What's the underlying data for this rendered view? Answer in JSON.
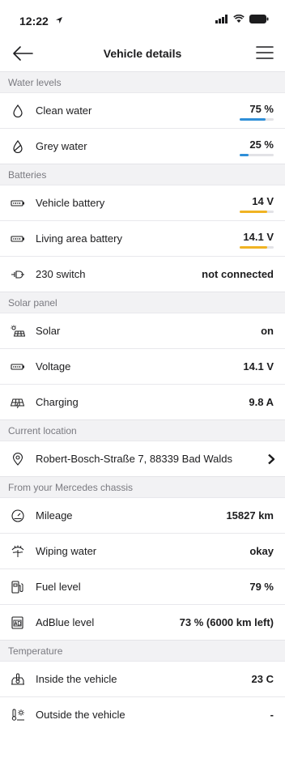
{
  "status": {
    "time": "12:22"
  },
  "header": {
    "title": "Vehicle details"
  },
  "sections": {
    "water": {
      "title": "Water levels",
      "clean": {
        "label": "Clean water",
        "value": "75 %",
        "level": 0.75
      },
      "grey": {
        "label": "Grey water",
        "value": "25 %",
        "level": 0.25
      }
    },
    "batteries": {
      "title": "Batteries",
      "vehicle": {
        "label": "Vehicle battery",
        "value": "14 V",
        "level": 0.8
      },
      "living": {
        "label": "Living area battery",
        "value": "14.1 V",
        "level": 0.8
      },
      "switch": {
        "label": "230 switch",
        "value": "not connected"
      }
    },
    "solar": {
      "title": "Solar panel",
      "solar": {
        "label": "Solar",
        "value": "on"
      },
      "voltage": {
        "label": "Voltage",
        "value": "14.1 V"
      },
      "charging": {
        "label": "Charging",
        "value": "9.8 A"
      }
    },
    "location": {
      "title": "Current location",
      "address": "Robert-Bosch-Straße 7, 88339 Bad Walds"
    },
    "chassis": {
      "title": "From your Mercedes chassis",
      "mileage": {
        "label": "Mileage",
        "value": "15827 km"
      },
      "wiping": {
        "label": "Wiping water",
        "value": "okay"
      },
      "fuel": {
        "label": "Fuel level",
        "value": "79 %"
      },
      "adblue": {
        "label": "AdBlue level",
        "value": "73 % (6000 km left)"
      }
    },
    "temperature": {
      "title": "Temperature",
      "inside": {
        "label": "Inside the vehicle",
        "value": "23 C"
      },
      "outside": {
        "label": "Outside the vehicle",
        "value": "-"
      }
    }
  },
  "colors": {
    "water_bar": "#2f8fd8",
    "battery_bar": "#f0b323"
  }
}
